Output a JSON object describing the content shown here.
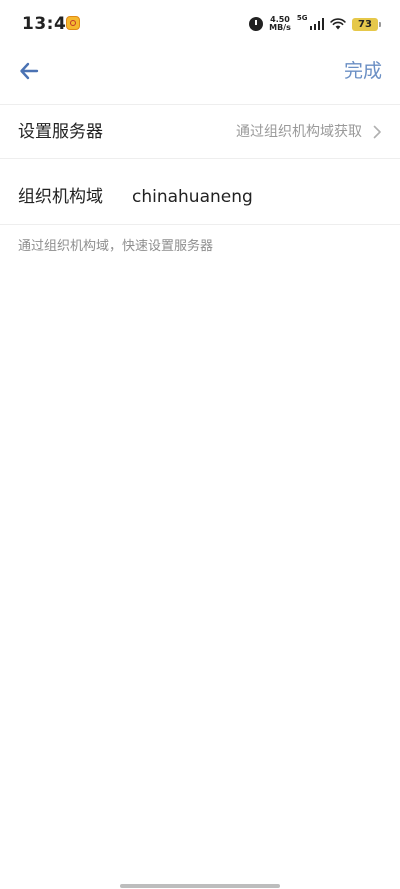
{
  "status_bar": {
    "time": "13:44",
    "net_speed_value": "4.50",
    "net_speed_unit": "MB/s",
    "network_type": "5G",
    "battery_level": "73"
  },
  "nav": {
    "back_icon": "arrow-left-icon",
    "done_label": "完成",
    "accent_color": "#6b8fc4"
  },
  "server_setting": {
    "label": "设置服务器",
    "value": "通过组织机构域获取",
    "chevron_icon": "chevron-right-icon"
  },
  "org_domain": {
    "label": "组织机构域",
    "value": "chinahuaneng"
  },
  "hint": "通过组织机构域，快速设置服务器"
}
